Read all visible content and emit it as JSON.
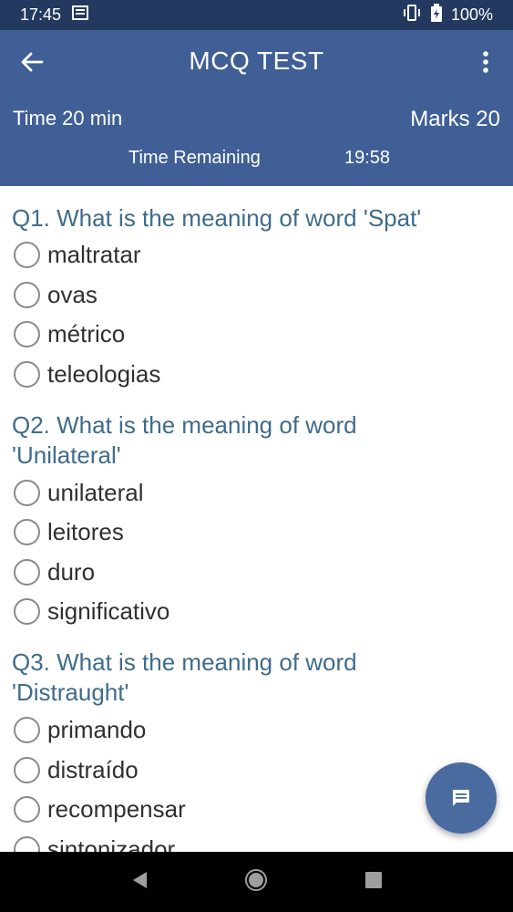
{
  "status_bar": {
    "time": "17:45",
    "battery": "100%",
    "icons": [
      "notification-icon",
      "vibrate-icon",
      "battery-charging-icon"
    ]
  },
  "app_bar": {
    "title": "MCQ TEST",
    "time_label": "Time 20 min",
    "marks_label": "Marks 20",
    "remaining_label": "Time Remaining",
    "remaining_value": "19:58",
    "background": "#3f5f96"
  },
  "questions": [
    {
      "text": "Q1. What is the meaning of word 'Spat'",
      "options": [
        "maltratar",
        "ovas",
        "métrico",
        "teleologias"
      ]
    },
    {
      "text": "Q2. What is the meaning of word 'Unilateral'",
      "options": [
        "unilateral",
        "leitores",
        "duro",
        "significativo"
      ]
    },
    {
      "text": "Q3. What is the meaning of word 'Distraught'",
      "options": [
        "primando",
        "distraído",
        "recompensar",
        "sintonizador"
      ]
    }
  ],
  "colors": {
    "question_text": "#3f6c8a",
    "fab": "#4a6ba0",
    "status_bar": "#23395f"
  }
}
